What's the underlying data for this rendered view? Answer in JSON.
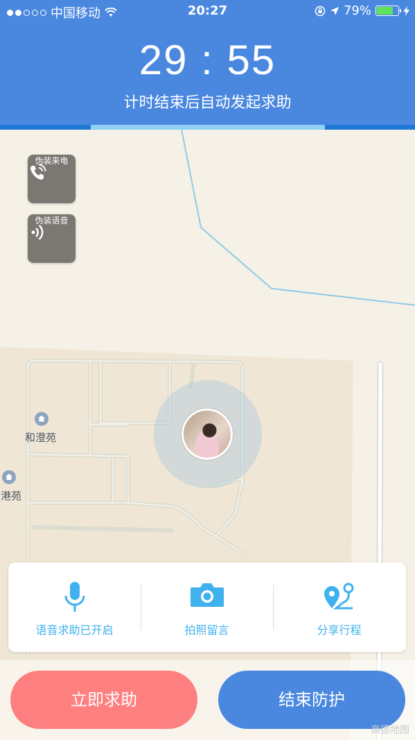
{
  "status_bar": {
    "carrier": "中国移动",
    "time": "20:27",
    "battery_percent": "79%",
    "battery_level": 0.79
  },
  "header": {
    "timer": "29 : 55",
    "subtitle": "计时结束后自动发起求助",
    "progress": 0.5
  },
  "float_buttons": [
    {
      "label": "伪装来电",
      "icon": "phone-ring-icon"
    },
    {
      "label": "伪装语音",
      "icon": "voice-wave-icon"
    }
  ],
  "map": {
    "pois": [
      "和澄苑",
      "润港苑"
    ]
  },
  "actions": [
    {
      "label": "语音求助已开启",
      "icon": "microphone-icon"
    },
    {
      "label": "拍照留言",
      "icon": "camera-icon"
    },
    {
      "label": "分享行程",
      "icon": "route-share-icon"
    }
  ],
  "buttons": {
    "help": "立即求助",
    "end": "结束防护"
  },
  "colors": {
    "header": "#4a88e0",
    "help_button": "#fe7f7f",
    "accent": "#3fb1ee"
  },
  "watermark": "高德地图"
}
